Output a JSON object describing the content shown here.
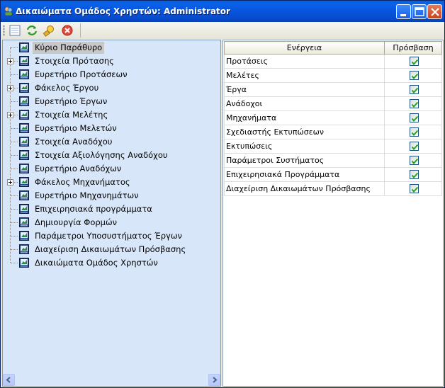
{
  "window": {
    "title": "Δικαιώματα Ομάδος Χρηστών: Administrator"
  },
  "toolbar": {
    "icons": [
      "new-icon",
      "refresh-icon",
      "find-icon",
      "close-icon"
    ]
  },
  "tree": {
    "items": [
      {
        "label": "Κύριο Παράθυρο",
        "expandable": false,
        "selected": true
      },
      {
        "label": "Στοιχεία Πρότασης",
        "expandable": true,
        "selected": false
      },
      {
        "label": "Ευρετήριο Προτάσεων",
        "expandable": false,
        "selected": false
      },
      {
        "label": "Φάκελος Έργου",
        "expandable": true,
        "selected": false
      },
      {
        "label": "Ευρετήριο Έργων",
        "expandable": false,
        "selected": false
      },
      {
        "label": "Στοιχεία Μελέτης",
        "expandable": true,
        "selected": false
      },
      {
        "label": "Ευρετήριο Μελετών",
        "expandable": false,
        "selected": false
      },
      {
        "label": "Στοιχεία Αναδόχου",
        "expandable": false,
        "selected": false
      },
      {
        "label": "Στοιχεία Αξιολόγησης Αναδόχου",
        "expandable": false,
        "selected": false
      },
      {
        "label": "Ευρετήριο Αναδόχων",
        "expandable": false,
        "selected": false
      },
      {
        "label": "Φάκελος  Μηχανήματος",
        "expandable": true,
        "selected": false
      },
      {
        "label": "Ευρετήριο Μηχανημάτων",
        "expandable": false,
        "selected": false
      },
      {
        "label": "Επιχειρησιακά προγράμματα",
        "expandable": false,
        "selected": false
      },
      {
        "label": "Δημιουργία Φορμών",
        "expandable": false,
        "selected": false
      },
      {
        "label": "Παράμετροι Υποσυστήματος Έργων",
        "expandable": false,
        "selected": false
      },
      {
        "label": "Διαχείριση Δικαιωμάτων Πρόσβασης",
        "expandable": false,
        "selected": false
      },
      {
        "label": "Δικαιώματα Ομάδος Χρηστών",
        "expandable": false,
        "selected": false
      }
    ]
  },
  "grid": {
    "headers": {
      "action": "Ενέργεια",
      "access": "Πρόσβαση"
    },
    "rows": [
      {
        "action": "Προτάσεις",
        "access": true
      },
      {
        "action": "Μελέτες",
        "access": true
      },
      {
        "action": "Έργα",
        "access": true
      },
      {
        "action": "Ανάδοχοι",
        "access": true
      },
      {
        "action": "Μηχανήματα",
        "access": true
      },
      {
        "action": "Σχεδιαστής Εκτυπώσεων",
        "access": true
      },
      {
        "action": "Εκτυπώσεις",
        "access": true
      },
      {
        "action": "Παράμετροι Συστήματος",
        "access": true
      },
      {
        "action": "Επιχειρησιακά Προγράμματα",
        "access": true
      },
      {
        "action": "Διαχείριση Δικαιωμάτων Πρόσβασης",
        "access": true
      }
    ]
  },
  "colors": {
    "titlebar": "#0855dd",
    "tree_background": "#d7e6f8",
    "check": "#21a121"
  }
}
